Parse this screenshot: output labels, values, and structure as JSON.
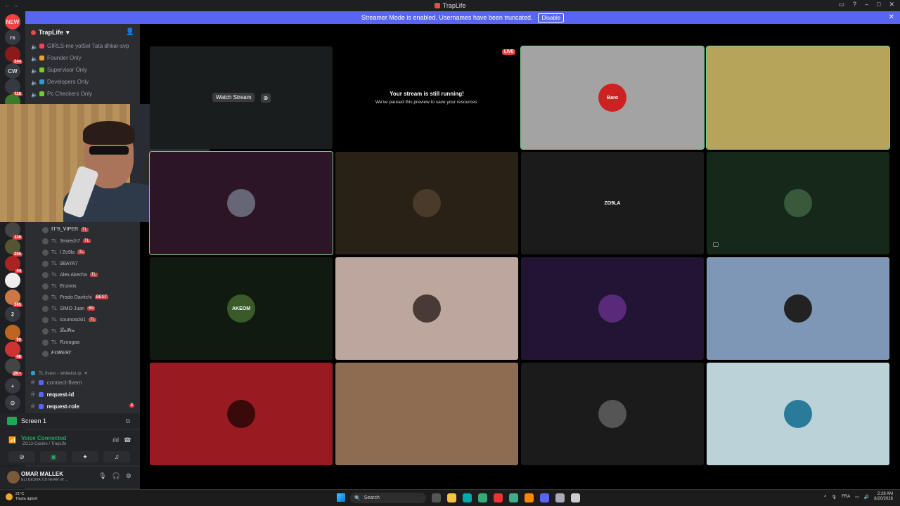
{
  "window": {
    "title": "TrapLife",
    "nav": "← →"
  },
  "banner": {
    "text": "Streamer Mode is enabled. Usernames have been truncated.",
    "button": "Disable",
    "close": "✕"
  },
  "rail": {
    "servers": [
      {
        "label": "NEW",
        "color": "#f23f43"
      },
      {
        "label": "rs",
        "color": "#36393f"
      },
      {
        "label": "",
        "color": "#8b1a1a",
        "badge": "344"
      },
      {
        "label": "CW",
        "color": "#36393f"
      },
      {
        "label": "",
        "color": "#36393f",
        "badge": "116"
      },
      {
        "label": "",
        "color": "#3a7a2a"
      },
      {
        "label": "",
        "color": "#444",
        "badge": "116"
      },
      {
        "label": "",
        "color": "#553",
        "badge": "305"
      },
      {
        "label": "",
        "color": "#a22",
        "badge": "44"
      },
      {
        "label": "",
        "color": "#eee"
      },
      {
        "label": "",
        "color": "#c74",
        "badge": "385"
      },
      {
        "label": "2",
        "color": "#36393f"
      },
      {
        "label": "",
        "color": "#b62",
        "badge": "90"
      },
      {
        "label": "",
        "color": "#c33",
        "badge": "48"
      },
      {
        "label": "",
        "color": "#444",
        "badge": "2K+"
      },
      {
        "label": "+",
        "color": "#36393f"
      },
      {
        "label": "⊙",
        "color": "#36393f"
      }
    ]
  },
  "sidebar": {
    "server_name": "TrapLife",
    "voice_channels": [
      {
        "label": "GIRLS-me yot5el 7ata dhkar-svp",
        "color": "#e45"
      },
      {
        "label": "Founder Only",
        "color": "#f0a030"
      },
      {
        "label": "Supervisor Only",
        "color": "#7c3"
      },
      {
        "label": "Developers Only",
        "color": "#39c"
      },
      {
        "label": "Pc Checkers Only",
        "color": "#7c3"
      }
    ],
    "members": [
      {
        "prefix": "",
        "name": "𝐈𝐓'𝐒_𝐕𝐈𝐏𝐄𝐑",
        "tag": "TL"
      },
      {
        "prefix": "TL",
        "name": "3mirech7",
        "tag": "TL"
      },
      {
        "prefix": "TL",
        "name": "l Zo9la",
        "tag": "TL"
      },
      {
        "prefix": "TL",
        "name": "9BAYA7",
        "tag": ""
      },
      {
        "prefix": "TL",
        "name": "Alex Akecha",
        "tag": "TL"
      },
      {
        "prefix": "TL",
        "name": "Enzoos",
        "tag": ""
      },
      {
        "prefix": "TL",
        "name": "Prado Davitchi",
        "tag": "BEST"
      },
      {
        "prefix": "TL",
        "name": "SIMO Juan",
        "tag": "69"
      },
      {
        "prefix": "TL",
        "name": "soumoscki1",
        "tag": "TL"
      },
      {
        "prefix": "TL",
        "name": "𝓛𝓪𝓟𝓲𝓷",
        "tag": ""
      },
      {
        "prefix": "TL",
        "name": "Rzougaa",
        "tag": ""
      },
      {
        "prefix": "",
        "name": "𝑭𝑶𝑹𝑬𝑺𝑻",
        "tag": ""
      }
    ],
    "category": "TL fivem - whitelist ip",
    "text_channels": [
      {
        "label": "connect-fivem",
        "bold": false
      },
      {
        "label": "request-id",
        "bold": true
      },
      {
        "label": "request-role",
        "bold": true,
        "badge": "1"
      }
    ]
  },
  "screen_share": {
    "label": "Screen 1"
  },
  "voice": {
    "status": "Voice Connected",
    "sub": "ZG13-Casino / TrapLife"
  },
  "user": {
    "name": "OMAR MALLEK",
    "status": "ELI BE3NA YJI NHAR W ..."
  },
  "stage": {
    "watch_label": "Watch Stream",
    "live_label": "LIVE",
    "paused_title": "Your stream is still running!",
    "paused_sub": "We've paused this preview to save your resources.",
    "tiles": [
      {
        "bg": "#a3a3a3",
        "avatar": "#c22",
        "label": "Baro",
        "selected": true
      },
      {
        "bg": "#b5a45a",
        "avatar": "#b5a45a",
        "label": "",
        "selected": true
      },
      {
        "bg": "#2c1626",
        "avatar": "#667",
        "label": "",
        "selected": true
      },
      {
        "bg": "#2a2116",
        "avatar": "#4a3a2a",
        "label": "",
        "selected": false
      },
      {
        "bg": "#1b1b1b",
        "avatar": "#1b1b1b",
        "label": "ZO9LA",
        "selected": false
      },
      {
        "bg": "#15281a",
        "avatar": "#385a3a",
        "label": "",
        "selected": false
      },
      {
        "bg": "#101a10",
        "avatar": "#3a5a2a",
        "label": "AKEOM",
        "selected": false
      },
      {
        "bg": "#bda69e",
        "avatar": "#4a3a36",
        "label": "",
        "selected": false
      },
      {
        "bg": "#221433",
        "avatar": "#5a2a7a",
        "label": "",
        "selected": false
      },
      {
        "bg": "#7f97b6",
        "avatar": "#222",
        "label": "",
        "selected": false
      },
      {
        "bg": "#9a1a22",
        "avatar": "#3a0a0a",
        "label": "",
        "selected": false
      },
      {
        "bg": "#8d6c52",
        "avatar": "#8d6c52",
        "label": "",
        "selected": false
      },
      {
        "bg": "#1b1b1b",
        "avatar": "#555",
        "label": "",
        "selected": false
      },
      {
        "bg": "#bcd2d9",
        "avatar": "#2a7a9a",
        "label": "",
        "selected": false
      }
    ]
  },
  "taskbar": {
    "weather_temp": "21°C",
    "weather_desc": "Tlazla dgbolt",
    "search": "Search",
    "lang": "FRA",
    "time": "2:28 AM",
    "date": "8/20/2026",
    "app_colors": [
      "#555",
      "#f5c542",
      "#0aa",
      "#3a7",
      "#e33",
      "#4a8",
      "#f80",
      "#5865f2",
      "#aab",
      "#ccc"
    ]
  }
}
